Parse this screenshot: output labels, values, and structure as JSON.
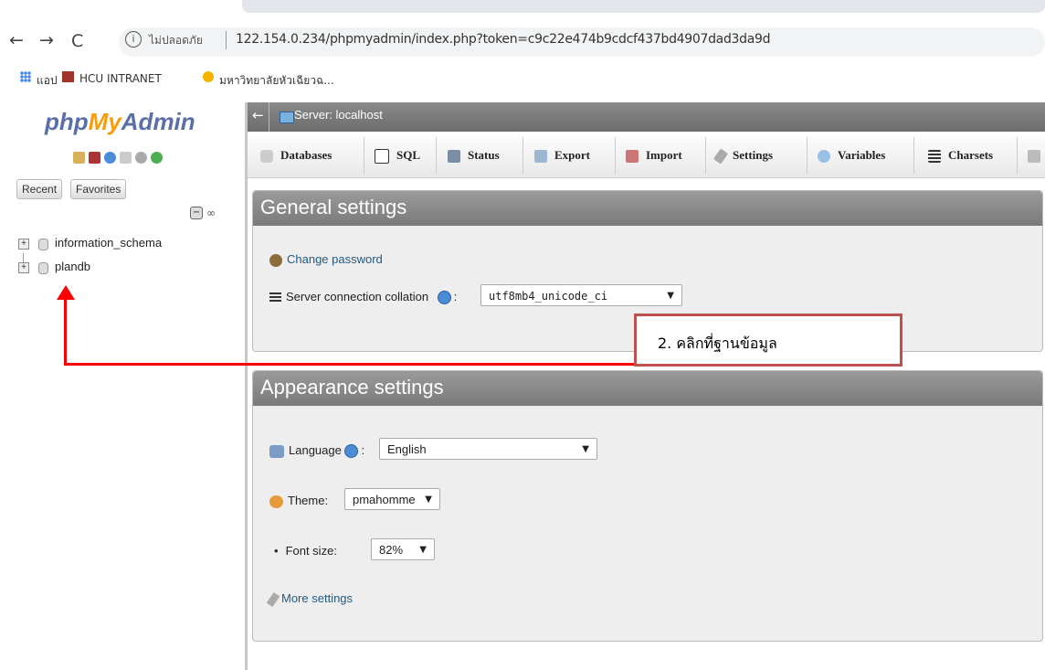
{
  "browser": {
    "nav_back": "←",
    "nav_forward": "→",
    "nav_reload": "C",
    "info_icon": "i",
    "security_label": "ไม่ปลอดภัย",
    "url": "122.154.0.234/phpmyadmin/index.php?token=c9c22e474b9cdcf437bd4907dad3da9d",
    "bookmarks": [
      {
        "label": "แอป",
        "icon": "apps-icon"
      },
      {
        "label": "HCU INTRANET",
        "icon": "building-icon"
      },
      {
        "label": "มหาวิทยาลัยหัวเฉียวฉ...",
        "icon": "university-icon"
      }
    ]
  },
  "pma": {
    "logo": {
      "php": "php",
      "my": "My",
      "admin": "Admin"
    },
    "nav_tabs": [
      "Recent",
      "Favorites"
    ],
    "collapse_symbol": "−",
    "link_symbol": "∞",
    "databases": [
      "information_schema",
      "plandb"
    ],
    "tree_plus": "+",
    "server_bar": {
      "back": "←",
      "label": "Server: localhost"
    },
    "menu": [
      {
        "label": "Databases",
        "icon": "database-icon"
      },
      {
        "label": "SQL",
        "icon": "sql-icon"
      },
      {
        "label": "Status",
        "icon": "status-icon"
      },
      {
        "label": "Export",
        "icon": "export-icon"
      },
      {
        "label": "Import",
        "icon": "import-icon"
      },
      {
        "label": "Settings",
        "icon": "wrench-icon"
      },
      {
        "label": "Variables",
        "icon": "variables-icon"
      },
      {
        "label": "Charsets",
        "icon": "charsets-icon"
      }
    ],
    "general": {
      "title": "General settings",
      "change_password": "Change password",
      "collation_label": "Server connection collation",
      "colon": ":",
      "collation_value": "utf8mb4_unicode_ci"
    },
    "appearance": {
      "title": "Appearance settings",
      "language_label": "Language",
      "language_value": "English",
      "theme_label": "Theme:",
      "theme_value": "pmahomme",
      "fontsize_label": "Font size:",
      "fontsize_value": "82%",
      "more_settings": "More settings"
    },
    "dropdown_arrow": "▼",
    "bullet": "•"
  },
  "annotation": {
    "text": "2. คลิกที่ฐานข้อมูล",
    "color": "#ff0000",
    "box_border": "#c0504d"
  }
}
